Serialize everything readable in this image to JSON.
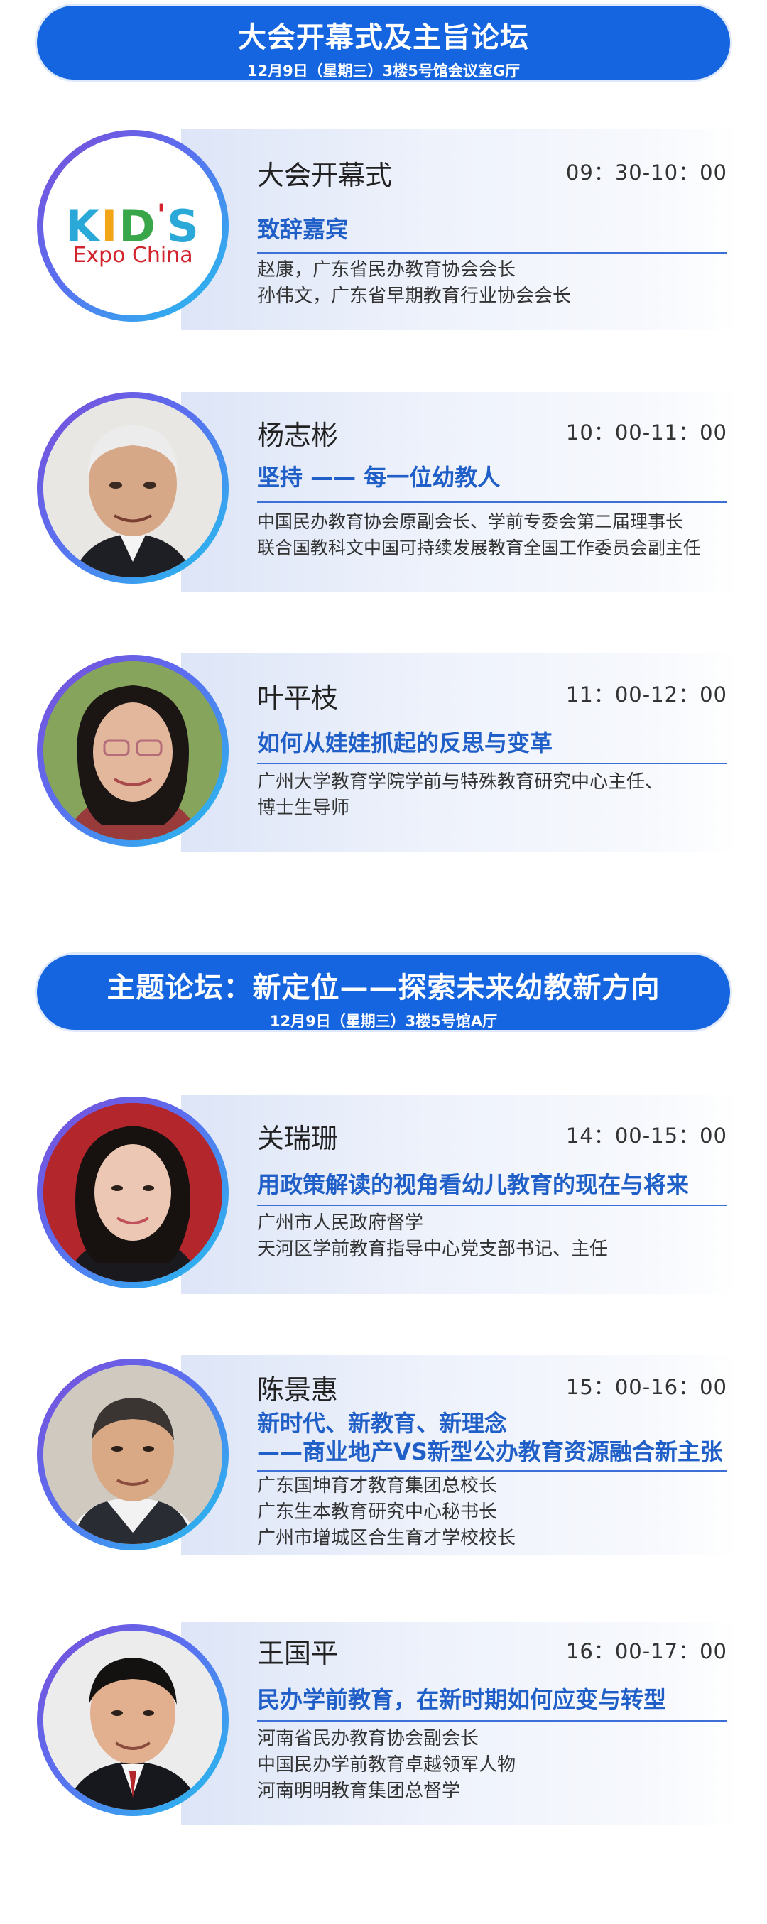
{
  "banners": [
    {
      "title": "大会开幕式及主旨论坛",
      "sub": "12月9日（星期三）3楼5号馆会议室G厅"
    },
    {
      "title": "主题论坛：新定位——探索未来幼教新方向",
      "sub": "12月9日（星期三）3楼5号馆A厅"
    }
  ],
  "logo": {
    "k": "K",
    "i": "I",
    "d": "D",
    "apos": "'",
    "s": "S",
    "expo": "Expo  China"
  },
  "sessions": [
    {
      "name": "大会开幕式",
      "time": "09：30-10：00",
      "topic": [
        "致辞嘉宾"
      ],
      "desc": [
        "赵康，广东省民办教育协会会长",
        "孙伟文，广东省早期教育行业协会会长"
      ]
    },
    {
      "name": "杨志彬",
      "time": "10：00-11：00",
      "topic": [
        "坚持 —— 每一位幼教人"
      ],
      "desc": [
        "中国民办教育协会原副会长、学前专委会第二届理事长",
        "联合国教科文中国可持续发展教育全国工作委员会副主任"
      ]
    },
    {
      "name": "叶平枝",
      "time": "11：00-12：00",
      "topic": [
        "如何从娃娃抓起的反思与变革"
      ],
      "desc": [
        "广州大学教育学院学前与特殊教育研究中心主任、",
        "博士生导师"
      ]
    },
    {
      "name": "关瑞珊",
      "time": "14：00-15：00",
      "topic": [
        "用政策解读的视角看幼儿教育的现在与将来"
      ],
      "desc": [
        "广州市人民政府督学",
        "天河区学前教育指导中心党支部书记、主任"
      ]
    },
    {
      "name": "陈景惠",
      "time": "15：00-16：00",
      "topic": [
        "新时代、新教育、新理念",
        "——商业地产VS新型公办教育资源融合新主张"
      ],
      "desc": [
        "广东国坤育才教育集团总校长",
        "广东生本教育研究中心秘书长",
        "广州市增城区合生育才学校校长"
      ]
    },
    {
      "name": "王国平",
      "time": "16：00-17：00",
      "topic": [
        "民办学前教育，在新时期如何应变与转型"
      ],
      "desc": [
        "河南省民办教育协会副会长",
        "中国民办学前教育卓越领军人物",
        "河南明明教育集团总督学"
      ]
    }
  ]
}
